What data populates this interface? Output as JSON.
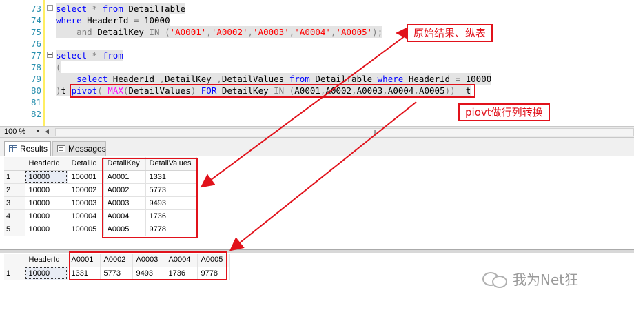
{
  "editor": {
    "lines": [
      {
        "num": "73",
        "tokens": [
          {
            "t": "select",
            "c": "kw"
          },
          {
            "t": " * ",
            "c": "gr"
          },
          {
            "t": "from",
            "c": "kw"
          },
          {
            "t": " DetailTable",
            "c": "tx"
          }
        ]
      },
      {
        "num": "74",
        "tokens": [
          {
            "t": "where",
            "c": "kw"
          },
          {
            "t": " HeaderId ",
            "c": "tx"
          },
          {
            "t": "=",
            "c": "gr"
          },
          {
            "t": " 10000",
            "c": "tx"
          }
        ]
      },
      {
        "num": "75",
        "tokens": [
          {
            "t": "    ",
            "c": "tx"
          },
          {
            "t": "and",
            "c": "gr"
          },
          {
            "t": " DetailKey ",
            "c": "tx"
          },
          {
            "t": "IN",
            "c": "gr"
          },
          {
            "t": " (",
            "c": "gr"
          },
          {
            "t": "'A0001'",
            "c": "str"
          },
          {
            "t": ",",
            "c": "gr"
          },
          {
            "t": "'A0002'",
            "c": "str"
          },
          {
            "t": ",",
            "c": "gr"
          },
          {
            "t": "'A0003'",
            "c": "str"
          },
          {
            "t": ",",
            "c": "gr"
          },
          {
            "t": "'A0004'",
            "c": "str"
          },
          {
            "t": ",",
            "c": "gr"
          },
          {
            "t": "'A0005'",
            "c": "str"
          },
          {
            "t": ");",
            "c": "gr"
          }
        ]
      },
      {
        "num": "76",
        "tokens": []
      },
      {
        "num": "77",
        "tokens": [
          {
            "t": "select",
            "c": "kw"
          },
          {
            "t": " * ",
            "c": "gr"
          },
          {
            "t": "from",
            "c": "kw"
          }
        ]
      },
      {
        "num": "78",
        "tokens": [
          {
            "t": "(",
            "c": "gr"
          }
        ]
      },
      {
        "num": "79",
        "tokens": [
          {
            "t": "    ",
            "c": "tx"
          },
          {
            "t": "select",
            "c": "kw"
          },
          {
            "t": " HeaderId ",
            "c": "tx"
          },
          {
            "t": ",",
            "c": "gr"
          },
          {
            "t": "DetailKey ",
            "c": "tx"
          },
          {
            "t": ",",
            "c": "gr"
          },
          {
            "t": "DetailValues ",
            "c": "tx"
          },
          {
            "t": "from",
            "c": "kw"
          },
          {
            "t": " DetailTable ",
            "c": "tx"
          },
          {
            "t": "where",
            "c": "kw"
          },
          {
            "t": " HeaderId ",
            "c": "tx"
          },
          {
            "t": "=",
            "c": "gr"
          },
          {
            "t": " 10000",
            "c": "tx"
          }
        ]
      },
      {
        "num": "80",
        "tokens": [
          {
            "t": ")",
            "c": "gr"
          },
          {
            "t": "t ",
            "c": "tx"
          },
          {
            "t": "pivot",
            "c": "kw"
          },
          {
            "t": "( ",
            "c": "gr"
          },
          {
            "t": "MAX",
            "c": "fn"
          },
          {
            "t": "(",
            "c": "gr"
          },
          {
            "t": "DetailValues",
            "c": "tx"
          },
          {
            "t": ") ",
            "c": "gr"
          },
          {
            "t": "FOR",
            "c": "kw"
          },
          {
            "t": " DetailKey ",
            "c": "tx"
          },
          {
            "t": "IN",
            "c": "gr"
          },
          {
            "t": " (",
            "c": "gr"
          },
          {
            "t": "A0001",
            "c": "tx"
          },
          {
            "t": ",",
            "c": "gr"
          },
          {
            "t": "A0002",
            "c": "tx"
          },
          {
            "t": ",",
            "c": "gr"
          },
          {
            "t": "A0003",
            "c": "tx"
          },
          {
            "t": ",",
            "c": "gr"
          },
          {
            "t": "A0004",
            "c": "tx"
          },
          {
            "t": ",",
            "c": "gr"
          },
          {
            "t": "A0005",
            "c": "tx"
          },
          {
            "t": ")",
            "c": "gr"
          },
          {
            "t": ")",
            "c": "gr"
          },
          {
            "t": "  t",
            "c": "tx"
          }
        ]
      },
      {
        "num": "81",
        "tokens": []
      },
      {
        "num": "82",
        "tokens": []
      }
    ]
  },
  "zoom": {
    "value": "100 %"
  },
  "tabs": {
    "results": "Results",
    "messages": "Messages"
  },
  "result1": {
    "columns": [
      "HeaderId",
      "DetailId",
      "DetailKey",
      "DetailValues"
    ],
    "rows": [
      {
        "num": "1",
        "cells": [
          "10000",
          "100001",
          "A0001",
          "1331"
        ]
      },
      {
        "num": "2",
        "cells": [
          "10000",
          "100002",
          "A0002",
          "5773"
        ]
      },
      {
        "num": "3",
        "cells": [
          "10000",
          "100003",
          "A0003",
          "9493"
        ]
      },
      {
        "num": "4",
        "cells": [
          "10000",
          "100004",
          "A0004",
          "1736"
        ]
      },
      {
        "num": "5",
        "cells": [
          "10000",
          "100005",
          "A0005",
          "9778"
        ]
      }
    ]
  },
  "result2": {
    "columns": [
      "HeaderId",
      "A0001",
      "A0002",
      "A0003",
      "A0004",
      "A0005"
    ],
    "rows": [
      {
        "num": "1",
        "cells": [
          "10000",
          "1331",
          "5773",
          "9493",
          "1736",
          "9778"
        ]
      }
    ]
  },
  "annotations": {
    "original_label": "原始结果、纵表",
    "pivot_label": "piovt做行列转换",
    "color": "#e1121b"
  },
  "watermark": {
    "text": "我为Net狂"
  }
}
